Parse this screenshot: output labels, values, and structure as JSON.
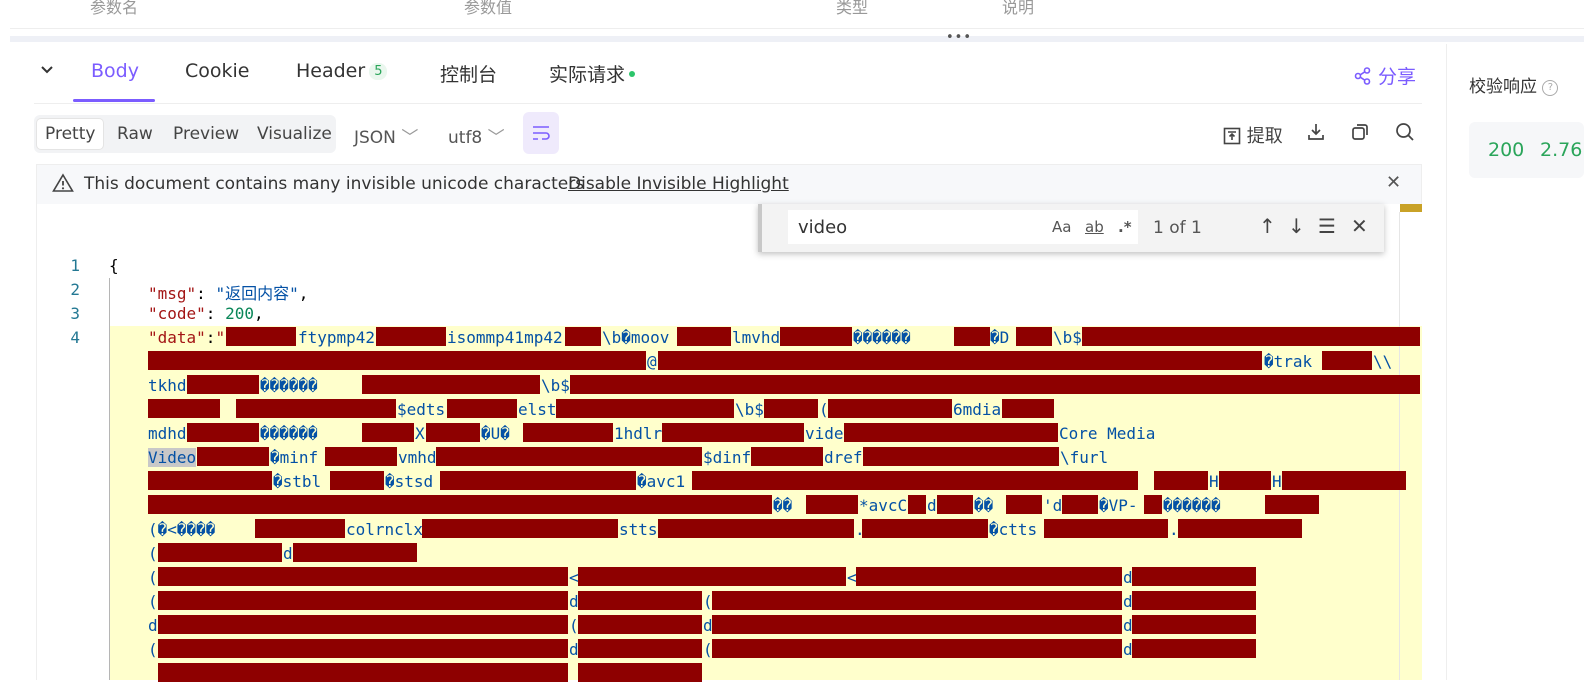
{
  "params_table": {
    "col_name": "参数名",
    "col_value": "参数值",
    "col_type": "类型",
    "col_desc": "说明"
  },
  "splitter_dots": "•••",
  "tabs": [
    {
      "label": "Body",
      "active": true
    },
    {
      "label": "Cookie"
    },
    {
      "label": "Header",
      "badge": "5"
    },
    {
      "label": "控制台"
    },
    {
      "label": "实际请求"
    }
  ],
  "share_label": "分享",
  "view_modes": [
    "Pretty",
    "Raw",
    "Preview",
    "Visualize"
  ],
  "format": "JSON",
  "encoding": "utf8",
  "toolbar": {
    "extract_label": "提取"
  },
  "warning": {
    "text": "This document contains many invisible unicode characters",
    "link": "Disable Invisible Highlight"
  },
  "find": {
    "query": "video",
    "count": "1 of 1",
    "match_case": "Aa",
    "whole_word": "ab",
    "regex": ".*"
  },
  "editor": {
    "line_numbers": [
      "1",
      "2",
      "3",
      "4"
    ],
    "line1": "{",
    "msg_key": "\"msg\"",
    "msg_val": "\"返回内容\"",
    "code_key": "\"code\"",
    "code_val": "200",
    "data_key": "\"data\"",
    "fragments": [
      "ftypmp42",
      "isommp41mp42",
      "\\b�moov",
      "lmvhd",
      "������",
      "�D",
      "\\b$",
      "@",
      "�trak",
      "\\\\",
      "tkhd",
      "������",
      "\\b$",
      "$edts",
      "elst",
      "\\b$",
      "(",
      "6mdia",
      "mdhd",
      "������",
      "X",
      "�U�",
      "1hdlr",
      "vide",
      "Core Media",
      "Video",
      "�minf",
      "vmhd",
      "$dinf",
      "dref",
      "\\furl",
      "�stbl",
      "�stsd",
      "�avc1",
      "H",
      "H",
      "��",
      "*avcC",
      "d",
      "��",
      "'d",
      "�VP-",
      "������",
      "(�<����",
      "colrnclx",
      "stts",
      ".",
      ".",
      "�ctts",
      ".",
      "(",
      "d",
      "(",
      "<",
      "<",
      "d",
      "(",
      "d",
      "(",
      "d",
      "d",
      "(",
      "d",
      "(",
      "d",
      "d",
      "(",
      "d",
      "(",
      "d"
    ]
  },
  "right_panel": {
    "title": "校验响应",
    "status": "200",
    "time": "2.76"
  },
  "colors": {
    "accent": "#7b5cff",
    "success": "#2aa55a",
    "nul_bg": "#8e0000",
    "highlight": "#ffffcc"
  }
}
